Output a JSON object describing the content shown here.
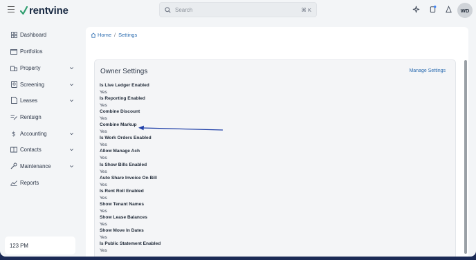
{
  "brand": {
    "name": "rentvine"
  },
  "search": {
    "placeholder": "Search",
    "shortcut": "⌘ K"
  },
  "top_icons": [
    "sparkle-icon",
    "notification-icon",
    "user-outline-icon"
  ],
  "user": {
    "initials": "WD"
  },
  "sidebar": {
    "items": [
      {
        "label": "Dashboard",
        "icon": "dashboard-icon",
        "expandable": false
      },
      {
        "label": "Portfolios",
        "icon": "portfolios-icon",
        "expandable": false
      },
      {
        "label": "Property",
        "icon": "property-icon",
        "expandable": true
      },
      {
        "label": "Screening",
        "icon": "screening-icon",
        "expandable": true
      },
      {
        "label": "Leases",
        "icon": "leases-icon",
        "expandable": true
      },
      {
        "label": "Rentsign",
        "icon": "rentsign-icon",
        "expandable": false
      },
      {
        "label": "Accounting",
        "icon": "accounting-icon",
        "expandable": true
      },
      {
        "label": "Contacts",
        "icon": "contacts-icon",
        "expandable": true
      },
      {
        "label": "Maintenance",
        "icon": "maintenance-icon",
        "expandable": true
      },
      {
        "label": "Reports",
        "icon": "reports-icon",
        "expandable": false
      }
    ],
    "time": "123 PM"
  },
  "breadcrumb": {
    "home": "Home",
    "separator": "/",
    "current": "Settings"
  },
  "owner_settings": {
    "title": "Owner Settings",
    "manage_label": "Manage Settings",
    "items": [
      {
        "label": "Is Live Ledger Enabled",
        "value": "Yes"
      },
      {
        "label": "Is Reporting Enabled",
        "value": "Yes"
      },
      {
        "label": "Combine Discount",
        "value": "Yes"
      },
      {
        "label": "Combine Markup",
        "value": "Yes"
      },
      {
        "label": "Is Work Orders Enabled",
        "value": "Yes"
      },
      {
        "label": "Allow Manage Ach",
        "value": "Yes"
      },
      {
        "label": "Is Show Bills Enabled",
        "value": "Yes"
      },
      {
        "label": "Auto Share Invoice On Bill",
        "value": "Yes"
      },
      {
        "label": "Is Rent Roll Enabled",
        "value": "Yes"
      },
      {
        "label": "Show Tenant Names",
        "value": "Yes"
      },
      {
        "label": "Show Lease Balances",
        "value": "Yes"
      },
      {
        "label": "Show Move In Dates",
        "value": "Yes"
      },
      {
        "label": "Is Public Statement Enabled",
        "value": "Yes"
      }
    ]
  },
  "colors": {
    "accent": "#2b6cb0",
    "arrow": "#1f3fa8",
    "frame": "#1b2a55"
  }
}
